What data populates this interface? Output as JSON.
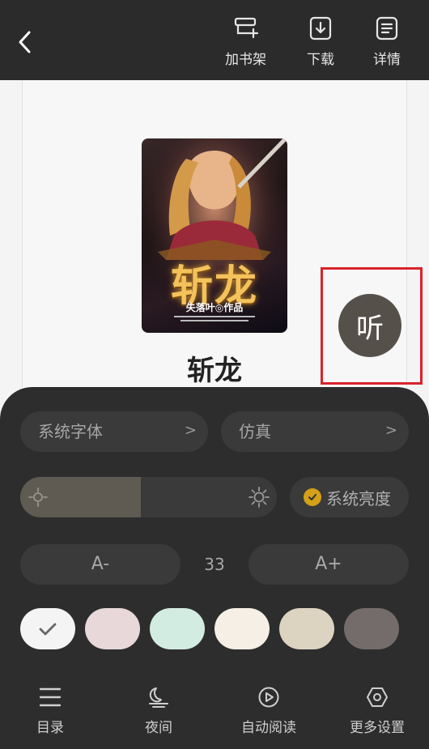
{
  "header": {
    "actions": [
      {
        "label": "加书架",
        "icon": "add-to-shelf-icon"
      },
      {
        "label": "下载",
        "icon": "download-icon"
      },
      {
        "label": "详情",
        "icon": "details-icon"
      }
    ]
  },
  "book": {
    "title": "斩龙",
    "cover_title": "斩龙",
    "cover_author": "失落叶◎作品"
  },
  "listen_button": {
    "label": "听"
  },
  "settings": {
    "font": {
      "label": "系统字体",
      "chevron": ">"
    },
    "page_turn": {
      "label": "仿真",
      "chevron": ">"
    },
    "brightness": {
      "level_percent": 47,
      "system_label": "系统亮度",
      "system_checked": true
    },
    "font_size": {
      "decrease": "A-",
      "value": "33",
      "increase": "A+"
    },
    "themes": [
      {
        "name": "white",
        "color": "#f4f4f4",
        "selected": true
      },
      {
        "name": "pink",
        "color": "#e8d8d9",
        "selected": false
      },
      {
        "name": "green",
        "color": "#d3ece2",
        "selected": false
      },
      {
        "name": "cream",
        "color": "#f6efe6",
        "selected": false
      },
      {
        "name": "beige",
        "color": "#ddd3c1",
        "selected": false
      },
      {
        "name": "dark-gray",
        "color": "#736c6a",
        "selected": false
      }
    ]
  },
  "bottom_nav": [
    {
      "label": "目录",
      "icon": "catalog-icon"
    },
    {
      "label": "夜间",
      "icon": "night-mode-icon"
    },
    {
      "label": "自动阅读",
      "icon": "auto-read-icon"
    },
    {
      "label": "更多设置",
      "icon": "more-settings-icon"
    }
  ],
  "colors": {
    "accent": "#d4a017",
    "highlight_border": "#d9222b"
  }
}
